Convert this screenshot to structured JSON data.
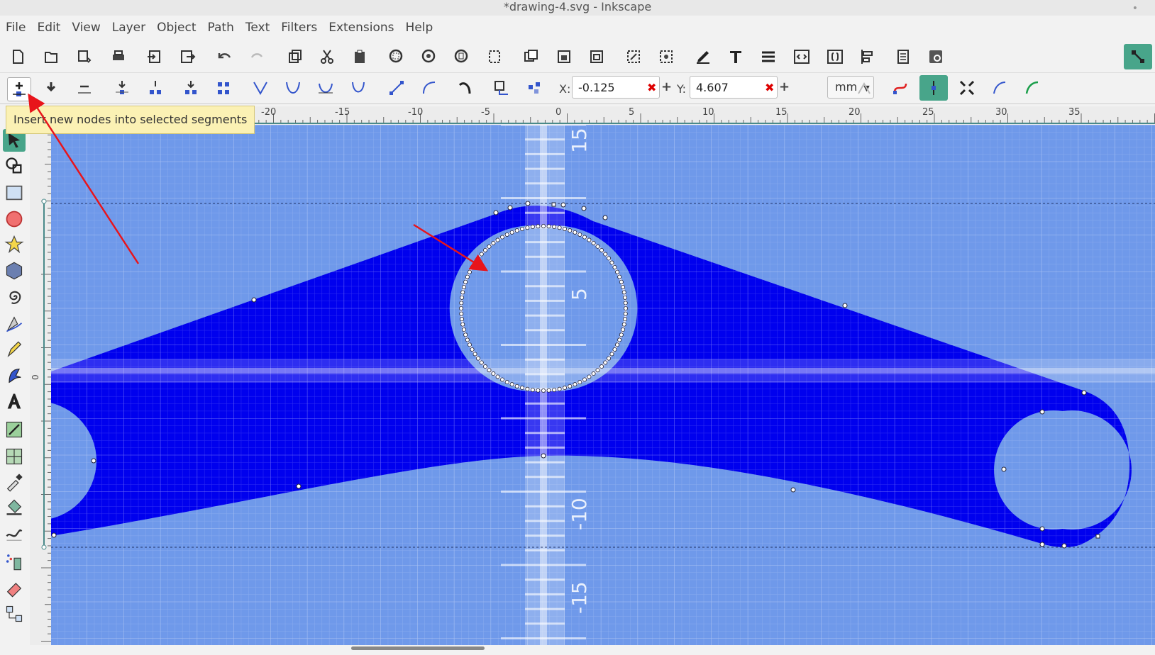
{
  "window": {
    "title": "*drawing-4.svg - Inkscape"
  },
  "menu": [
    "File",
    "Edit",
    "View",
    "Layer",
    "Object",
    "Path",
    "Text",
    "Filters",
    "Extensions",
    "Help"
  ],
  "commands": [
    "new-document-icon",
    "open-document-icon",
    "open-recent-icon",
    "print-icon",
    "import-icon",
    "export-icon",
    "undo-icon",
    "redo-icon",
    "duplicate-icon",
    "cut-icon",
    "paste-icon",
    "zoom-selection-icon",
    "zoom-drawing-icon",
    "zoom-page-icon",
    "zoom-page-width-icon",
    "group-icon",
    "ungroup-icon",
    "lock-icon",
    "transform-icon",
    "snap-objects-icon",
    "fill-stroke-icon",
    "text-font-icon",
    "layers-icon",
    "xml-editor-icon",
    "selectors-icon",
    "align-icon",
    "document-properties-icon",
    "preferences-icon"
  ],
  "node_toolbar": {
    "x_label": "X:",
    "x_value": "-0.125",
    "y_label": "Y:",
    "y_value": "4.607",
    "unit": "mm"
  },
  "tooltip": {
    "text": "Insert new nodes into selected segments"
  },
  "ruler": {
    "top_labels": [
      "-20",
      "-15",
      "-10",
      "-5",
      "0",
      "5",
      "10",
      "15",
      "20",
      "25",
      "30",
      "35"
    ],
    "left_labels": [
      "0"
    ]
  },
  "canvas_labels": [
    "15",
    "5",
    "-10",
    "-15"
  ],
  "colors": {
    "shape_fill": "#0000ee",
    "canvas_bg": "#6f99ea",
    "arrow": "#e8141b",
    "tooltip_bg": "#fbf1b4"
  },
  "tools": [
    "selector-tool-icon",
    "node-tool-icon",
    "rect-tool-icon",
    "ellipse-tool-icon",
    "star-tool-icon",
    "3dbox-tool-icon",
    "spiral-tool-icon",
    "pen-tool-icon",
    "pencil-tool-icon",
    "calligraphy-tool-icon",
    "text-tool-icon",
    "gradient-tool-icon",
    "mesh-tool-icon",
    "dropper-tool-icon",
    "paint-bucket-tool-icon",
    "tweak-tool-icon",
    "spray-tool-icon",
    "eraser-tool-icon",
    "connector-tool-icon"
  ]
}
